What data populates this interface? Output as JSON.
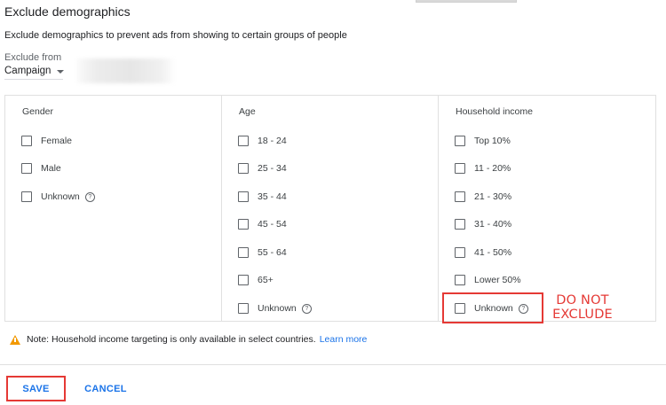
{
  "header": {
    "title": "Exclude demographics",
    "description": "Exclude demographics to prevent ads from showing to certain groups of people"
  },
  "exclude_from": {
    "label": "Exclude from",
    "selected": "Campaign"
  },
  "columns": {
    "gender": {
      "header": "Gender",
      "options": [
        "Female",
        "Male",
        "Unknown"
      ]
    },
    "age": {
      "header": "Age",
      "options": [
        "18 - 24",
        "25 - 34",
        "35 - 44",
        "45 - 54",
        "55 - 64",
        "65+",
        "Unknown"
      ]
    },
    "income": {
      "header": "Household income",
      "options": [
        "Top 10%",
        "11 - 20%",
        "21 - 30%",
        "31 - 40%",
        "41 - 50%",
        "Lower 50%",
        "Unknown"
      ]
    }
  },
  "annotation": {
    "line1": "DO NOT",
    "line2": "EXCLUDE",
    "color": "#e53935"
  },
  "note": {
    "text": "Note: Household income targeting is only available in select countries.",
    "link": "Learn more"
  },
  "actions": {
    "save": "SAVE",
    "cancel": "CANCEL"
  },
  "colors": {
    "accent": "#1a73e8",
    "warning": "#f29900"
  },
  "icons": {
    "help": "help-circle-icon",
    "warning": "warning-triangle-icon",
    "dropdown": "caret-down-icon"
  }
}
